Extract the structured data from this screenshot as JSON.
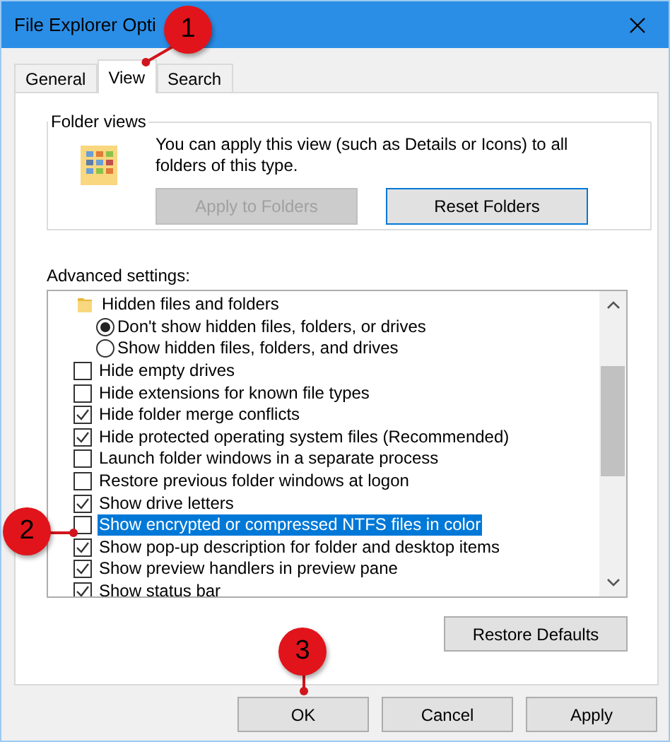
{
  "window": {
    "title": "File Explorer Opti"
  },
  "tabs": [
    {
      "label": "General",
      "selected": false
    },
    {
      "label": "View",
      "selected": true
    },
    {
      "label": "Search",
      "selected": false
    }
  ],
  "folder_views": {
    "title": "Folder views",
    "description": "You can apply this view (such as Details or Icons) to all folders of this type.",
    "buttons": [
      {
        "label": "Apply to Folders",
        "disabled": true
      },
      {
        "label": "Reset Folders",
        "disabled": false
      }
    ]
  },
  "advanced_settings": {
    "label": "Advanced settings:",
    "items": [
      {
        "kind": "folder",
        "label": "Hidden files and folders",
        "selected": false,
        "children": [
          {
            "kind": "radio",
            "label": "Don't show hidden files, folders, or drives",
            "checked": true,
            "selected": false
          },
          {
            "kind": "radio",
            "label": "Show hidden files, folders, and drives",
            "checked": false,
            "selected": false
          }
        ]
      },
      {
        "kind": "checkbox",
        "label": "Hide empty drives",
        "checked": false,
        "selected": false
      },
      {
        "kind": "checkbox",
        "label": "Hide extensions for known file types",
        "checked": false,
        "selected": false
      },
      {
        "kind": "checkbox",
        "label": "Hide folder merge conflicts",
        "checked": true,
        "selected": false
      },
      {
        "kind": "checkbox",
        "label": "Hide protected operating system files (Recommended)",
        "checked": true,
        "selected": false
      },
      {
        "kind": "checkbox",
        "label": "Launch folder windows in a separate process",
        "checked": false,
        "selected": false
      },
      {
        "kind": "checkbox",
        "label": "Restore previous folder windows at logon",
        "checked": false,
        "selected": false
      },
      {
        "kind": "checkbox",
        "label": "Show drive letters",
        "checked": true,
        "selected": false
      },
      {
        "kind": "checkbox",
        "label": "Show encrypted or compressed NTFS files in color",
        "checked": false,
        "selected": true
      },
      {
        "kind": "checkbox",
        "label": "Show pop-up description for folder and desktop items",
        "checked": true,
        "selected": false
      },
      {
        "kind": "checkbox",
        "label": "Show preview handlers in preview pane",
        "checked": true,
        "selected": false
      },
      {
        "kind": "checkbox",
        "label": "Show status bar",
        "checked": true,
        "selected": false
      }
    ],
    "restore_button": "Restore Defaults"
  },
  "buttons": [
    "OK",
    "Cancel",
    "Apply"
  ],
  "callouts": [
    {
      "number": "1"
    },
    {
      "number": "2"
    },
    {
      "number": "3"
    }
  ]
}
